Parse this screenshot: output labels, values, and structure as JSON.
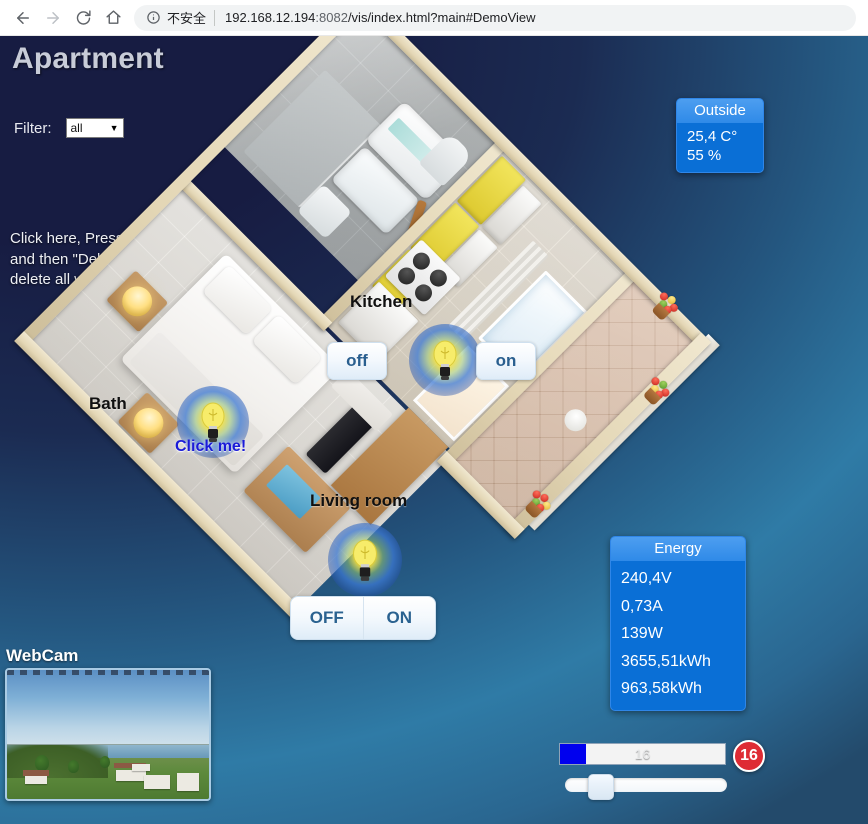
{
  "browser": {
    "back_icon": "back-arrow-icon",
    "forward_icon": "forward-arrow-icon",
    "reload_icon": "reload-icon",
    "home_icon": "home-icon",
    "info_icon": "info-circle-icon",
    "security_label": "不安全",
    "url_host": "192.168.12.194",
    "url_port": ":8082",
    "url_path": "/vis/index.html?main#DemoView"
  },
  "header": {
    "title": "Apartment",
    "filter_label": "Filter:",
    "filter_value": "all",
    "filter_options": [
      "all"
    ],
    "caret_icon": "chevron-down-icon"
  },
  "hint": {
    "text": "Click here, Press Ctrl+A\nand then \"Del\" to\ndelete all widgets"
  },
  "rooms": {
    "kitchen_label": "Kitchen",
    "bath_label": "Bath",
    "living_label": "Living room"
  },
  "controls": {
    "kitchen_off": "off",
    "kitchen_on": "on",
    "living_off": "OFF",
    "living_on": "ON",
    "click_me": "Click me!",
    "bulb_icon": "light-bulb-icon"
  },
  "outside_panel": {
    "title": "Outside",
    "rows": [
      "25,4 C°",
      "55 %"
    ]
  },
  "energy_panel": {
    "title": "Energy",
    "rows": [
      "240,4V",
      "0,73A",
      "139W",
      "3655,51kWh",
      "963,58kWh"
    ]
  },
  "bottom_controls": {
    "progress_value": "16",
    "progress_percent": 16,
    "badge_value": "16",
    "slider_percent": 16
  },
  "webcam": {
    "title": "WebCam",
    "image_alt": "coastal-landscape-photo"
  },
  "colors": {
    "accent_blue": "#0a6fd6",
    "panel_header_blue": "#3f93ec",
    "badge_red": "#de2b34",
    "progress_blue": "#0000ee",
    "button_text": "#2a6290",
    "link_blue": "#1b1bd8",
    "bg_navy": "#171c42",
    "bg_steel": "#2f7ba6"
  }
}
